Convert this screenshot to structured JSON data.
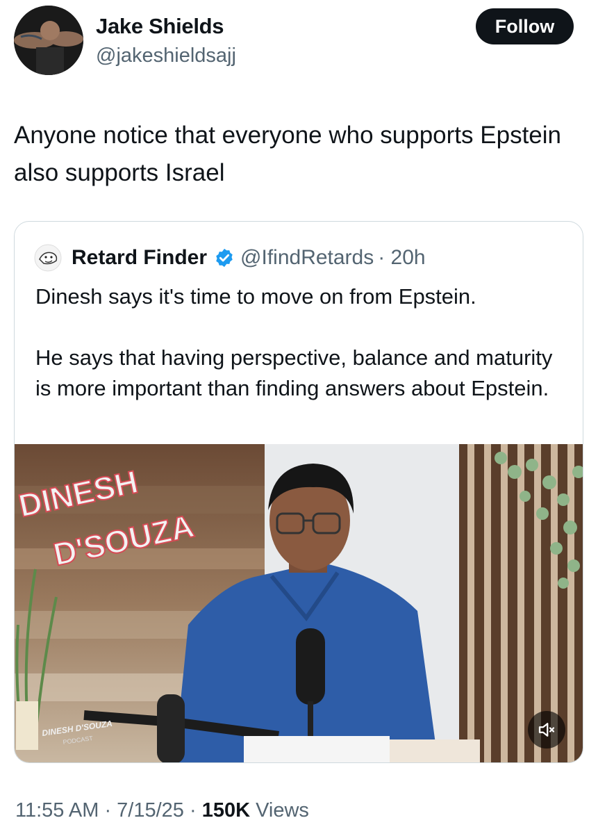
{
  "author": {
    "name": "Jake Shields",
    "handle": "@jakeshieldsajj",
    "follow_label": "Follow"
  },
  "tweet": {
    "text": "Anyone notice that everyone who supports Epstein also supports Israel"
  },
  "quoted": {
    "name": "Retard Finder",
    "handle": "@IfindRetards",
    "time": "· 20h",
    "paragraphs": [
      "Dinesh says it's time to move on from Epstein.",
      "He says that having perspective, balance and maturity is more important than finding answers about Epstein."
    ],
    "video": {
      "sign_line1": "DINESH",
      "sign_line2": "D'SOUZA",
      "podcast_label_line1": "DINESH D'SOUZA",
      "podcast_label_line2": "PODCAST"
    }
  },
  "meta": {
    "time": "11:55 AM",
    "sep1": " · ",
    "date": "7/15/25",
    "sep2": " · ",
    "views_count": "150K",
    "views_label": " Views"
  },
  "icons": {
    "verified": "verified-badge-icon",
    "mute": "speaker-muted-icon"
  },
  "colors": {
    "follow_bg": "#0f1419",
    "verified_blue": "#1d9bf0",
    "secondary_text": "#536471",
    "border": "#cfd9de"
  }
}
